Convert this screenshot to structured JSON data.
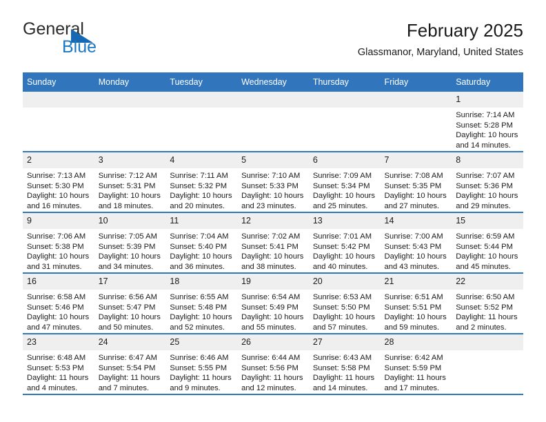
{
  "brand": {
    "name_top": "General",
    "name_bottom": "Blue",
    "accent_color": "#1b78c4"
  },
  "header": {
    "title": "February 2025",
    "subtitle": "Glassmanor, Maryland, United States"
  },
  "theme": {
    "header_row_color": "#3176bc",
    "daynum_band_color": "#efefef",
    "row_border_color": "#3176bc"
  },
  "weekday_headers": [
    "Sunday",
    "Monday",
    "Tuesday",
    "Wednesday",
    "Thursday",
    "Friday",
    "Saturday"
  ],
  "weeks": [
    [
      {
        "day": "",
        "sunrise": "",
        "sunset": "",
        "daylight": "",
        "daylight2": ""
      },
      {
        "day": "",
        "sunrise": "",
        "sunset": "",
        "daylight": "",
        "daylight2": ""
      },
      {
        "day": "",
        "sunrise": "",
        "sunset": "",
        "daylight": "",
        "daylight2": ""
      },
      {
        "day": "",
        "sunrise": "",
        "sunset": "",
        "daylight": "",
        "daylight2": ""
      },
      {
        "day": "",
        "sunrise": "",
        "sunset": "",
        "daylight": "",
        "daylight2": ""
      },
      {
        "day": "",
        "sunrise": "",
        "sunset": "",
        "daylight": "",
        "daylight2": ""
      },
      {
        "day": "1",
        "sunrise": "Sunrise: 7:14 AM",
        "sunset": "Sunset: 5:28 PM",
        "daylight": "Daylight: 10 hours",
        "daylight2": "and 14 minutes."
      }
    ],
    [
      {
        "day": "2",
        "sunrise": "Sunrise: 7:13 AM",
        "sunset": "Sunset: 5:30 PM",
        "daylight": "Daylight: 10 hours",
        "daylight2": "and 16 minutes."
      },
      {
        "day": "3",
        "sunrise": "Sunrise: 7:12 AM",
        "sunset": "Sunset: 5:31 PM",
        "daylight": "Daylight: 10 hours",
        "daylight2": "and 18 minutes."
      },
      {
        "day": "4",
        "sunrise": "Sunrise: 7:11 AM",
        "sunset": "Sunset: 5:32 PM",
        "daylight": "Daylight: 10 hours",
        "daylight2": "and 20 minutes."
      },
      {
        "day": "5",
        "sunrise": "Sunrise: 7:10 AM",
        "sunset": "Sunset: 5:33 PM",
        "daylight": "Daylight: 10 hours",
        "daylight2": "and 23 minutes."
      },
      {
        "day": "6",
        "sunrise": "Sunrise: 7:09 AM",
        "sunset": "Sunset: 5:34 PM",
        "daylight": "Daylight: 10 hours",
        "daylight2": "and 25 minutes."
      },
      {
        "day": "7",
        "sunrise": "Sunrise: 7:08 AM",
        "sunset": "Sunset: 5:35 PM",
        "daylight": "Daylight: 10 hours",
        "daylight2": "and 27 minutes."
      },
      {
        "day": "8",
        "sunrise": "Sunrise: 7:07 AM",
        "sunset": "Sunset: 5:36 PM",
        "daylight": "Daylight: 10 hours",
        "daylight2": "and 29 minutes."
      }
    ],
    [
      {
        "day": "9",
        "sunrise": "Sunrise: 7:06 AM",
        "sunset": "Sunset: 5:38 PM",
        "daylight": "Daylight: 10 hours",
        "daylight2": "and 31 minutes."
      },
      {
        "day": "10",
        "sunrise": "Sunrise: 7:05 AM",
        "sunset": "Sunset: 5:39 PM",
        "daylight": "Daylight: 10 hours",
        "daylight2": "and 34 minutes."
      },
      {
        "day": "11",
        "sunrise": "Sunrise: 7:04 AM",
        "sunset": "Sunset: 5:40 PM",
        "daylight": "Daylight: 10 hours",
        "daylight2": "and 36 minutes."
      },
      {
        "day": "12",
        "sunrise": "Sunrise: 7:02 AM",
        "sunset": "Sunset: 5:41 PM",
        "daylight": "Daylight: 10 hours",
        "daylight2": "and 38 minutes."
      },
      {
        "day": "13",
        "sunrise": "Sunrise: 7:01 AM",
        "sunset": "Sunset: 5:42 PM",
        "daylight": "Daylight: 10 hours",
        "daylight2": "and 40 minutes."
      },
      {
        "day": "14",
        "sunrise": "Sunrise: 7:00 AM",
        "sunset": "Sunset: 5:43 PM",
        "daylight": "Daylight: 10 hours",
        "daylight2": "and 43 minutes."
      },
      {
        "day": "15",
        "sunrise": "Sunrise: 6:59 AM",
        "sunset": "Sunset: 5:44 PM",
        "daylight": "Daylight: 10 hours",
        "daylight2": "and 45 minutes."
      }
    ],
    [
      {
        "day": "16",
        "sunrise": "Sunrise: 6:58 AM",
        "sunset": "Sunset: 5:46 PM",
        "daylight": "Daylight: 10 hours",
        "daylight2": "and 47 minutes."
      },
      {
        "day": "17",
        "sunrise": "Sunrise: 6:56 AM",
        "sunset": "Sunset: 5:47 PM",
        "daylight": "Daylight: 10 hours",
        "daylight2": "and 50 minutes."
      },
      {
        "day": "18",
        "sunrise": "Sunrise: 6:55 AM",
        "sunset": "Sunset: 5:48 PM",
        "daylight": "Daylight: 10 hours",
        "daylight2": "and 52 minutes."
      },
      {
        "day": "19",
        "sunrise": "Sunrise: 6:54 AM",
        "sunset": "Sunset: 5:49 PM",
        "daylight": "Daylight: 10 hours",
        "daylight2": "and 55 minutes."
      },
      {
        "day": "20",
        "sunrise": "Sunrise: 6:53 AM",
        "sunset": "Sunset: 5:50 PM",
        "daylight": "Daylight: 10 hours",
        "daylight2": "and 57 minutes."
      },
      {
        "day": "21",
        "sunrise": "Sunrise: 6:51 AM",
        "sunset": "Sunset: 5:51 PM",
        "daylight": "Daylight: 10 hours",
        "daylight2": "and 59 minutes."
      },
      {
        "day": "22",
        "sunrise": "Sunrise: 6:50 AM",
        "sunset": "Sunset: 5:52 PM",
        "daylight": "Daylight: 11 hours",
        "daylight2": "and 2 minutes."
      }
    ],
    [
      {
        "day": "23",
        "sunrise": "Sunrise: 6:48 AM",
        "sunset": "Sunset: 5:53 PM",
        "daylight": "Daylight: 11 hours",
        "daylight2": "and 4 minutes."
      },
      {
        "day": "24",
        "sunrise": "Sunrise: 6:47 AM",
        "sunset": "Sunset: 5:54 PM",
        "daylight": "Daylight: 11 hours",
        "daylight2": "and 7 minutes."
      },
      {
        "day": "25",
        "sunrise": "Sunrise: 6:46 AM",
        "sunset": "Sunset: 5:55 PM",
        "daylight": "Daylight: 11 hours",
        "daylight2": "and 9 minutes."
      },
      {
        "day": "26",
        "sunrise": "Sunrise: 6:44 AM",
        "sunset": "Sunset: 5:56 PM",
        "daylight": "Daylight: 11 hours",
        "daylight2": "and 12 minutes."
      },
      {
        "day": "27",
        "sunrise": "Sunrise: 6:43 AM",
        "sunset": "Sunset: 5:58 PM",
        "daylight": "Daylight: 11 hours",
        "daylight2": "and 14 minutes."
      },
      {
        "day": "28",
        "sunrise": "Sunrise: 6:42 AM",
        "sunset": "Sunset: 5:59 PM",
        "daylight": "Daylight: 11 hours",
        "daylight2": "and 17 minutes."
      },
      {
        "day": "",
        "sunrise": "",
        "sunset": "",
        "daylight": "",
        "daylight2": ""
      }
    ]
  ]
}
